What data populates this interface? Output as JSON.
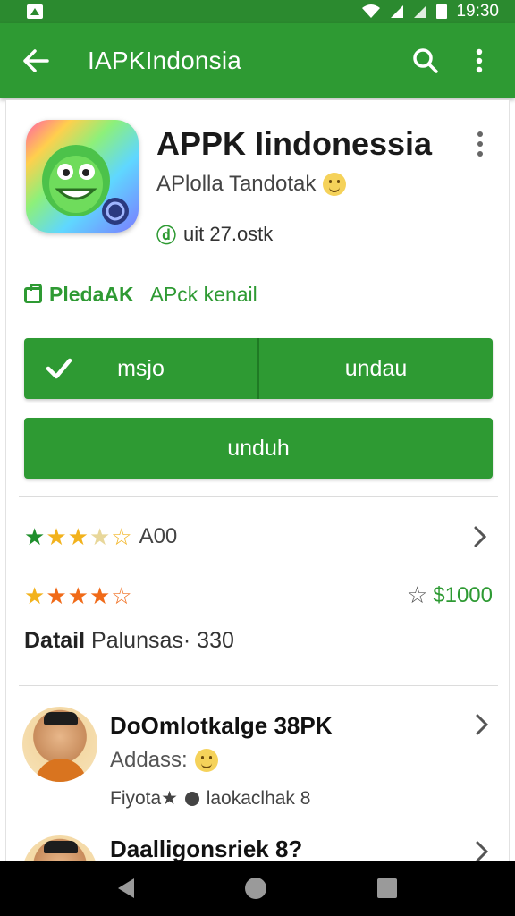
{
  "status_bar": {
    "time": "19:30"
  },
  "app_bar": {
    "title": "IAPKIndonsia"
  },
  "app": {
    "name": "APPK Iindonessia",
    "developer": "APlolla Tandotak",
    "downloads": "uit  27.ostk"
  },
  "badges": {
    "main": "PledaAK",
    "secondary": "APck kenail"
  },
  "buttons": {
    "split_left": "msjo",
    "split_right": "undau",
    "full": "unduh"
  },
  "ratings": {
    "row1_label": "A00",
    "row1_stars": 3.5,
    "row2_stars": 4,
    "price": "$1000"
  },
  "detail": {
    "key": "Datail",
    "value": "Palunsas· 330"
  },
  "reviews": [
    {
      "name": "DoOmlotkalge 38PK",
      "sub": "Addass:",
      "meta_left": "Fiyota★",
      "meta_right": "laokaclhak  8"
    },
    {
      "name": "Daalligonsriek 8?"
    }
  ],
  "colors": {
    "primary": "#2e9a33",
    "status_bar": "#2b8a2f",
    "star_green": "#1f8f2c",
    "star_orange": "#f06a18",
    "star_yellow": "#f2b21c"
  }
}
